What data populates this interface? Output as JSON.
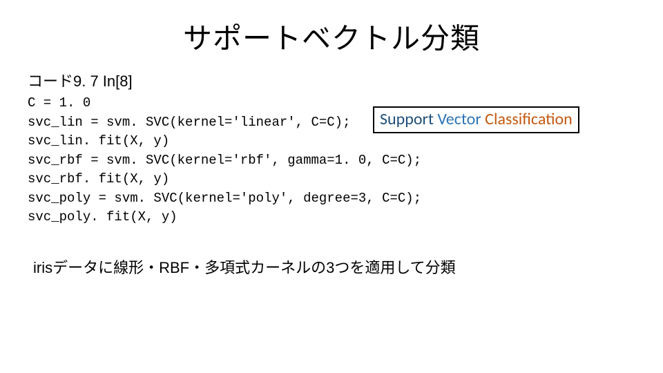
{
  "title": "サポートベクトル分類",
  "subheader": "コード9. 7 In[8]",
  "code": "C = 1. 0\nsvc_lin = svm. SVC(kernel='linear', C=C);\nsvc_lin. fit(X, y)\nsvc_rbf = svm. SVC(kernel='rbf', gamma=1. 0, C=C);\nsvc_rbf. fit(X, y)\nsvc_poly = svm. SVC(kernel='poly', degree=3, C=C);\nsvc_poly. fit(X, y)",
  "callout": {
    "word1": "Support",
    "word2": "Vector",
    "word3": "Classification"
  },
  "body": "irisデータに線形・RBF・多項式カーネルの3つを適用して分類"
}
